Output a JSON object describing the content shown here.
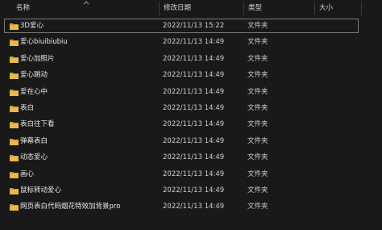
{
  "columns": {
    "name": "名称",
    "date": "修改日期",
    "type": "类型",
    "size": "大小"
  },
  "icons": {
    "folder": "folder-icon",
    "sort": "chevron-up-icon"
  },
  "colors": {
    "folder": "#e8b84a",
    "background": "#191919",
    "selection_border": "#7a7a7a"
  },
  "rows": [
    {
      "name": "3D爱心",
      "date": "2022/11/13 15:22",
      "type": "文件夹",
      "selected": true
    },
    {
      "name": "爱心biuibiubiu",
      "date": "2022/11/13 14:49",
      "type": "文件夹"
    },
    {
      "name": "爱心加照片",
      "date": "2022/11/13 14:49",
      "type": "文件夹"
    },
    {
      "name": "爱心跳动",
      "date": "2022/11/13 14:49",
      "type": "文件夹"
    },
    {
      "name": "爱在心中",
      "date": "2022/11/13 14:49",
      "type": "文件夹"
    },
    {
      "name": "表白",
      "date": "2022/11/13 14:49",
      "type": "文件夹"
    },
    {
      "name": "表白往下看",
      "date": "2022/11/13 14:49",
      "type": "文件夹"
    },
    {
      "name": "弹幕表白",
      "date": "2022/11/13 14:49",
      "type": "文件夹"
    },
    {
      "name": "动态爱心",
      "date": "2022/11/13 14:49",
      "type": "文件夹"
    },
    {
      "name": "画心",
      "date": "2022/11/13 14:49",
      "type": "文件夹"
    },
    {
      "name": "鼠标转动爱心",
      "date": "2022/11/13 14:49",
      "type": "文件夹"
    },
    {
      "name": "网页表白代码烟花特效加背景pro",
      "date": "2022/11/13 14:49",
      "type": "文件夹"
    }
  ]
}
